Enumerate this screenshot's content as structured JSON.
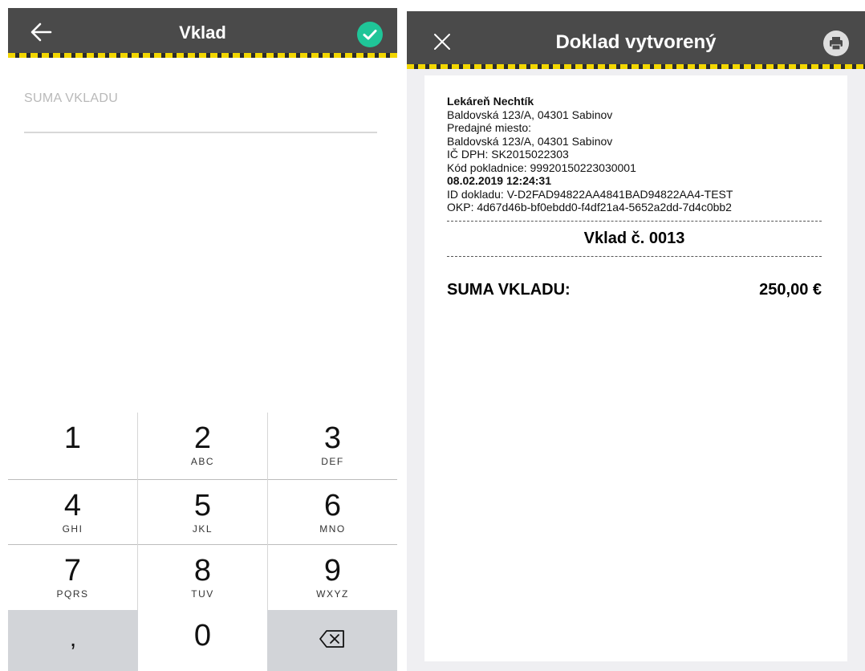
{
  "left_screen": {
    "title": "Vklad",
    "back_icon": "arrow-left-icon",
    "confirm_icon": "check-circle-icon",
    "field": {
      "label": "SUMA VKLADU",
      "value": ""
    },
    "keypad": {
      "keys": [
        {
          "digit": "1",
          "letters": ""
        },
        {
          "digit": "2",
          "letters": "ABC"
        },
        {
          "digit": "3",
          "letters": "DEF"
        },
        {
          "digit": "4",
          "letters": "GHI"
        },
        {
          "digit": "5",
          "letters": "JKL"
        },
        {
          "digit": "6",
          "letters": "MNO"
        },
        {
          "digit": "7",
          "letters": "PQRS"
        },
        {
          "digit": "8",
          "letters": "TUV"
        },
        {
          "digit": "9",
          "letters": "WXYZ"
        }
      ],
      "comma": ",",
      "zero": "0",
      "delete_icon": "backspace-icon"
    },
    "colors": {
      "bar": "#4a4a4a",
      "accent": "#1fc598",
      "stripe": "#f2d600"
    }
  },
  "right_screen": {
    "title": "Doklad vytvorený",
    "close_icon": "close-icon",
    "print_icon": "printer-icon",
    "receipt": {
      "company": "Lekáreň Nechtík",
      "address": "Baldovská 123/A, 04301 Sabinov",
      "place_label": "Predajné miesto:",
      "place_address": "Baldovská 123/A, 04301 Sabinov",
      "vat_id": "IČ DPH: SK2015022303",
      "register_code": "Kód pokladnice: 99920150223030001",
      "datetime": "08.02.2019 12:24:31",
      "document_id": "ID dokladu: V-D2FAD94822AA4841BAD94822AA4-TEST",
      "okp": "OKP: 4d67d46b-bf0ebdd0-f4df21a4-5652a2dd-7d4c0bb2",
      "heading": "Vklad č. 0013",
      "sum_label": "SUMA VKLADU:",
      "sum_value": "250,00 €"
    }
  }
}
